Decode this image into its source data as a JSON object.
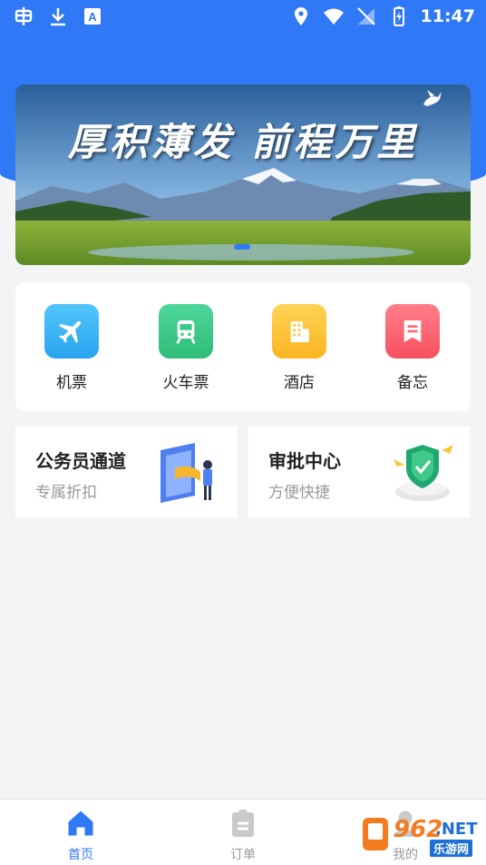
{
  "status_bar": {
    "time": "11:47",
    "left_icons": [
      "bug-icon",
      "download-icon",
      "font-icon"
    ],
    "right_icons": [
      "location-icon",
      "wifi-icon",
      "no-signal-icon",
      "battery-icon"
    ]
  },
  "colors": {
    "primary": "#2f79f6",
    "background": "#f4f4f4"
  },
  "banner": {
    "slogan": "厚积薄发  前程万里",
    "active_dot": 1
  },
  "menu": {
    "items": [
      {
        "label": "机票",
        "icon": "airplane-icon",
        "color": "#3fb8f5"
      },
      {
        "label": "火车票",
        "icon": "train-icon",
        "color": "#3cc98a"
      },
      {
        "label": "酒店",
        "icon": "hotel-icon",
        "color": "#fcc33a"
      },
      {
        "label": "备忘",
        "icon": "memo-icon",
        "color": "#fd6a78"
      }
    ]
  },
  "features": [
    {
      "title": "公务员通道",
      "subtitle": "专属折扣",
      "icon": "civil-servant-illustration"
    },
    {
      "title": "审批中心",
      "subtitle": "方便快捷",
      "icon": "approval-shield-illustration"
    }
  ],
  "tabbar": {
    "tabs": [
      {
        "label": "首页",
        "icon": "home-icon",
        "active": true
      },
      {
        "label": "订单",
        "icon": "order-icon",
        "active": false
      },
      {
        "label": "我的",
        "icon": "profile-icon",
        "active": false
      }
    ],
    "active_color": "#2f79f6",
    "inactive_color": "#9a9a9a"
  },
  "watermark": {
    "num": "962",
    "net": ".NET",
    "cn": "乐游网"
  }
}
